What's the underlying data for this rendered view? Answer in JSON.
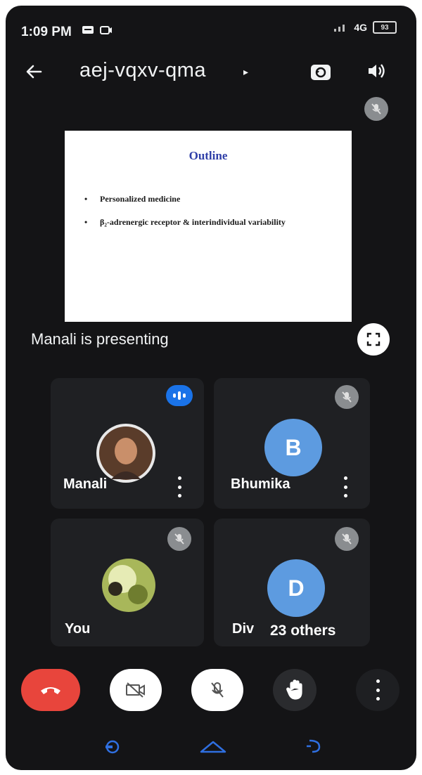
{
  "status_bar": {
    "time": "1:09 PM",
    "network": "4G",
    "battery": "93"
  },
  "toolbar": {
    "meeting_code": "aej-vqxv-qma",
    "caret": "▸"
  },
  "presentation": {
    "slide_title": "Outline",
    "bullets": [
      "Personalized medicine",
      "β₂-adrenergic receptor & interindividual variability"
    ],
    "presenting_label": "Manali is presenting"
  },
  "participants": [
    {
      "name": "Manali",
      "avatar": "photo",
      "status": "speaking"
    },
    {
      "name": "Bhumika",
      "avatar_letter": "B",
      "status": "muted"
    },
    {
      "name": "You",
      "avatar": "photo",
      "status": "muted"
    },
    {
      "name": "Div",
      "avatar_letter": "D",
      "status": "muted"
    }
  ],
  "others_label": "23 others",
  "controls": {
    "end_call": "phone-hangup-icon",
    "camera": "camera-off-icon",
    "mic": "mic-off-icon",
    "raise_hand": "hand-icon",
    "more": "more-vertical-icon"
  },
  "colors": {
    "end_call": "#e8453c",
    "accent": "#1a73e8",
    "avatar": "#5d9be0",
    "background": "#141416"
  }
}
